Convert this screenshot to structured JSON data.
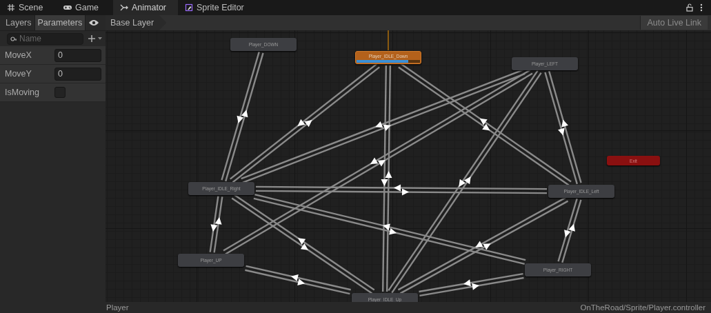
{
  "window_tabs": [
    {
      "label": "Scene",
      "selected": false
    },
    {
      "label": "Game",
      "selected": false
    },
    {
      "label": "Animator",
      "selected": true
    },
    {
      "label": "Sprite Editor",
      "selected": false
    }
  ],
  "panel_tabs": [
    {
      "label": "Layers",
      "selected": false
    },
    {
      "label": "Parameters",
      "selected": true
    }
  ],
  "search": {
    "placeholder": "Name"
  },
  "parameters": [
    {
      "name": "MoveX",
      "kind": "float",
      "value": "0"
    },
    {
      "name": "MoveY",
      "kind": "float",
      "value": "0"
    },
    {
      "name": "IsMoving",
      "kind": "bool",
      "checked": false
    }
  ],
  "breadcrumb": "Base Layer",
  "auto_live_link": "Auto Live Link",
  "states": [
    {
      "name": "Player_DOWN",
      "kind": "state",
      "active": false
    },
    {
      "name": "Player_IDLE_Down",
      "kind": "state",
      "active": true,
      "level": 0.82
    },
    {
      "name": "Player_LEFT",
      "kind": "state",
      "active": false
    },
    {
      "name": "Exit",
      "kind": "exit"
    },
    {
      "name": "Player_IDLE_Right",
      "kind": "state",
      "active": false
    },
    {
      "name": "Player_IDLE_Left",
      "kind": "state",
      "active": false
    },
    {
      "name": "Player_UP",
      "kind": "state",
      "active": false
    },
    {
      "name": "Player_RIGHT",
      "kind": "state",
      "active": false
    },
    {
      "name": "Player_IDLE_Up",
      "kind": "state",
      "active": false
    }
  ],
  "status_bar": {
    "left": "Player",
    "right": "OnTheRoad/Sprite/Player.controller"
  }
}
